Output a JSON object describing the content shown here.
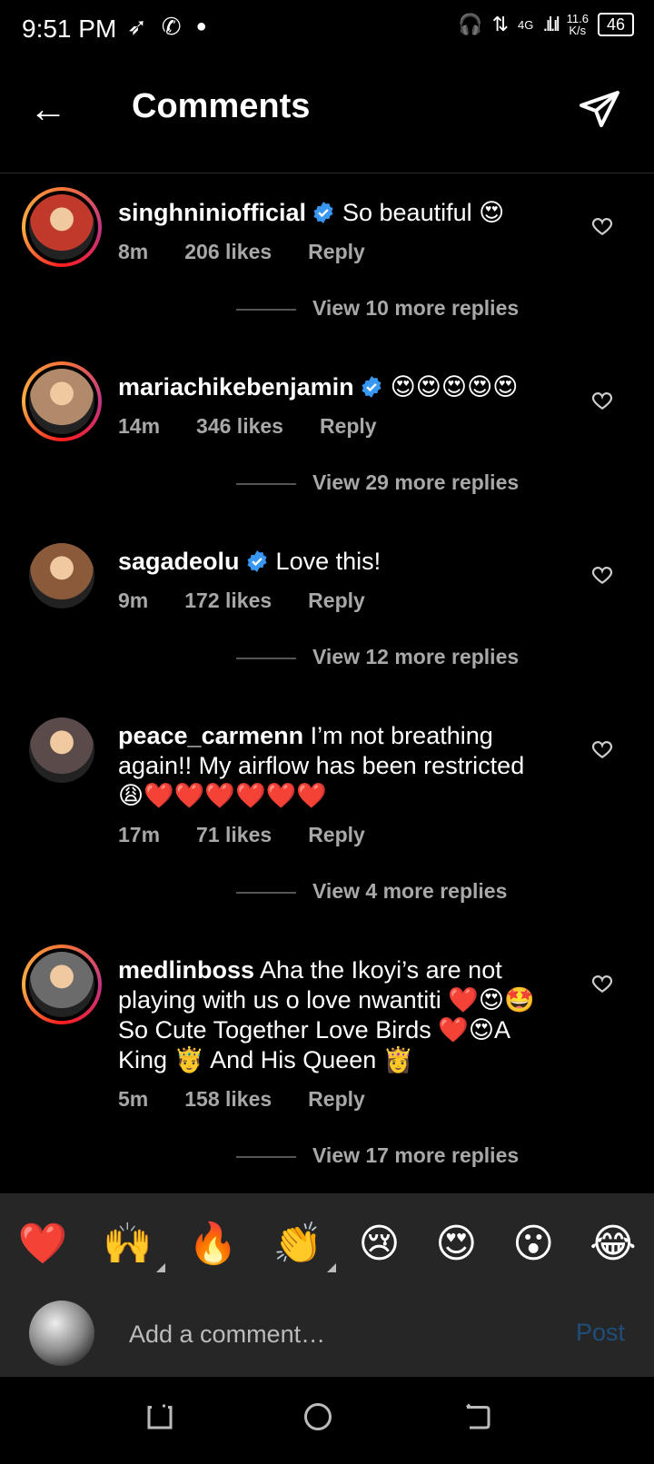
{
  "status_bar": {
    "time": "9:51 PM",
    "network": "4G",
    "speed_value": "11.6",
    "speed_unit": "K/s",
    "battery": "46"
  },
  "header": {
    "title": "Comments"
  },
  "comments": [
    {
      "username": "singhniniofficial",
      "verified": true,
      "text": "So beautiful 😍",
      "time": "8m",
      "likes": "206 likes",
      "reply": "Reply",
      "view_more": "View 10 more replies",
      "story_ring": true,
      "avatar_color": "#c0392b"
    },
    {
      "username": "mariachikebenjamin",
      "verified": true,
      "text": "😍😍😍😍😍",
      "time": "14m",
      "likes": "346 likes",
      "reply": "Reply",
      "view_more": "View 29 more replies",
      "story_ring": true,
      "avatar_color": "#b08a6a"
    },
    {
      "username": "sagadeolu",
      "verified": true,
      "text": "Love this!",
      "time": "9m",
      "likes": "172 likes",
      "reply": "Reply",
      "view_more": "View 12 more replies",
      "story_ring": false,
      "avatar_color": "#8a5a3a"
    },
    {
      "username": "peace_carmenn",
      "verified": false,
      "text": "I’m not breathing again!! My airflow has been restricted 😩❤️❤️❤️❤️❤️❤️",
      "time": "17m",
      "likes": "71 likes",
      "reply": "Reply",
      "view_more": "View 4 more replies",
      "story_ring": false,
      "avatar_color": "#5a4a4a"
    },
    {
      "username": "medlinboss",
      "verified": false,
      "text": "Aha the Ikoyi’s are not playing with us o love nwantiti ❤️😍🤩So Cute Together Love Birds ❤️😍A King 🤴 And His Queen 👸",
      "time": "5m",
      "likes": "158 likes",
      "reply": "Reply",
      "view_more": "View 17 more replies",
      "story_ring": true,
      "avatar_color": "#6b6b6b"
    }
  ],
  "emoji_bar": [
    "❤️",
    "🙌",
    "🔥",
    "👏",
    "😢",
    "😍",
    "😮",
    "😂"
  ],
  "composer": {
    "placeholder": "Add a comment…",
    "post_label": "Post"
  },
  "colors": {
    "verified_blue": "#3897f0",
    "post_disabled": "#1f4e7a",
    "panel_bg": "#262626"
  }
}
